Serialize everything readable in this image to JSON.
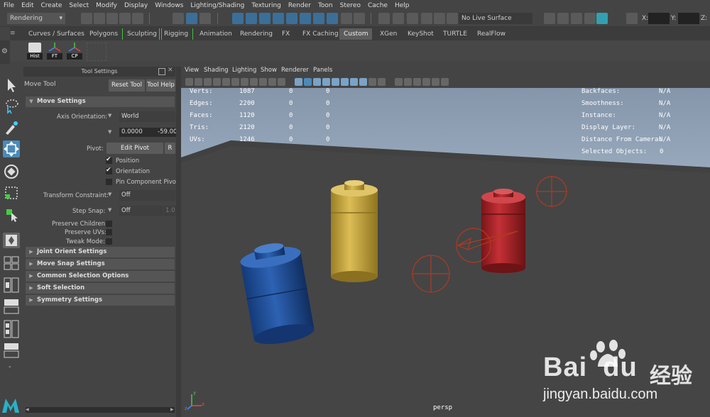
{
  "menubar": [
    "File",
    "Edit",
    "Create",
    "Select",
    "Modify",
    "Display",
    "Windows",
    "Lighting/Shading",
    "Texturing",
    "Render",
    "Toon",
    "Stereo",
    "Cache",
    "Help"
  ],
  "statusline": {
    "menuset": "Rendering",
    "live_surface": "No Live Surface",
    "coord_labels": [
      "X:",
      "Y:",
      "Z:"
    ]
  },
  "shelf_tabs": [
    "Curves / Surfaces",
    "Polygons",
    "Sculpting",
    "Rigging",
    "Animation",
    "Rendering",
    "FX",
    "FX Caching",
    "Custom",
    "XGen",
    "KeyShot",
    "TURTLE",
    "RealFlow"
  ],
  "shelf_active_tab": "Custom",
  "shelf_items": [
    "Hist",
    "FT",
    "CP"
  ],
  "tool_settings": {
    "panel_title": "Tool Settings",
    "tool_name": "Move Tool",
    "reset_button": "Reset Tool",
    "help_button": "Tool Help",
    "move_settings": {
      "header": "Move Settings",
      "axis_orientation_label": "Axis Orientation:",
      "axis_orientation_value": "World",
      "field_1": "0.0000",
      "field_2": "-59.00",
      "pivot_label": "Pivot:",
      "edit_pivot_button": "Edit Pivot",
      "reset_pivot_button": "R",
      "position_label": "Position",
      "position_checked": true,
      "orientation_label": "Orientation",
      "orientation_checked": true,
      "pin_component_label": "Pin Component Pivot",
      "pin_component_checked": false,
      "transform_constraint_label": "Transform Constraint:",
      "transform_constraint_value": "Off",
      "step_snap_label": "Step Snap:",
      "step_snap_value": "Off",
      "step_snap_amount": "1.0",
      "preserve_children_label": "Preserve Children:",
      "preserve_uvs_label": "Preserve UVs:",
      "tweak_mode_label": "Tweak Mode:"
    },
    "collapsed_sections": [
      "Joint Orient Settings",
      "Move Snap Settings",
      "Common Selection Options",
      "Soft Selection",
      "Symmetry Settings"
    ]
  },
  "viewport": {
    "menu": [
      "View",
      "Shading",
      "Lighting",
      "Show",
      "Renderer",
      "Panels"
    ],
    "hud_left": [
      {
        "label": "Verts:",
        "values": [
          "1087",
          "0",
          "0"
        ]
      },
      {
        "label": "Edges:",
        "values": [
          "2200",
          "0",
          "0"
        ]
      },
      {
        "label": "Faces:",
        "values": [
          "1120",
          "0",
          "0"
        ]
      },
      {
        "label": "Tris:",
        "values": [
          "2120",
          "0",
          "0"
        ]
      },
      {
        "label": "UVs:",
        "values": [
          "1246",
          "0",
          "0"
        ]
      }
    ],
    "hud_right": [
      {
        "label": "Backfaces:",
        "value": "N/A"
      },
      {
        "label": "Smoothness:",
        "value": "N/A"
      },
      {
        "label": "Instance:",
        "value": "N/A"
      },
      {
        "label": "Display Layer:",
        "value": "N/A"
      },
      {
        "label": "Distance From Camera:",
        "value": "N/A"
      },
      {
        "label": "Selected Objects:",
        "value": "0"
      }
    ],
    "camera_name": "persp",
    "axis_labels": [
      "y",
      "x",
      "z"
    ]
  },
  "watermark": {
    "brand": "Bai",
    "brand_tail": "du",
    "chinese": "经验",
    "url": "jingyan.baidu.com"
  },
  "colors": {
    "accent": "#4c8ab8",
    "background_top": "#8fa4ba",
    "grid_floor": "#4a4a4a",
    "cylinder_blue": "#1f4f9a",
    "cylinder_yellow": "#c8a83c",
    "cylinder_red": "#a82426"
  }
}
